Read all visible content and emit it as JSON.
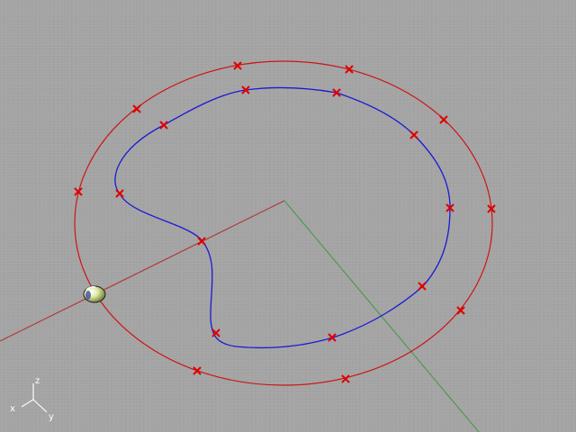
{
  "viewport": {
    "colors": {
      "background": "#a4a4a4",
      "world_x_axis": "#b03a3a",
      "world_y_axis": "#4f9a4f",
      "outer_curve": "#cc1515",
      "inner_curve": "#1a1ad6",
      "control_point": "#e00000",
      "gizmo_axes": "#ffffff"
    },
    "gizmo": {
      "z_label": "z",
      "x_label": "x",
      "y_label": "y"
    },
    "grab_handle_icon": "ball-handle-icon"
  }
}
